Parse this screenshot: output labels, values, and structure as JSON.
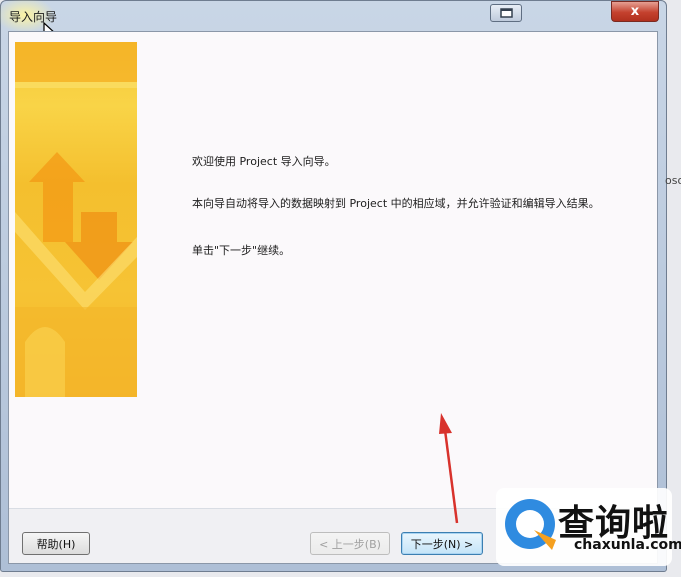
{
  "window": {
    "title": "导入向导",
    "close_glyph": "x"
  },
  "message": {
    "line1": "欢迎使用 Project 导入向导。",
    "line2": "本向导自动将导入的数据映射到 Project 中的相应域，并允许验证和编辑导入结果。",
    "line3": "单击\"下一步\"继续。"
  },
  "buttons": {
    "help": "帮助(H)",
    "back": "< 上一步(B)",
    "next": "下一步(N) >"
  },
  "watermark": {
    "main": "查询啦",
    "sub": "chaxunla.com"
  },
  "background_fragment": "oso",
  "colors": {
    "banner_yellow": "#f6c838",
    "close_red": "#c4412e",
    "annotation_red": "#d8322c",
    "watermark_blue": "#2f8be0",
    "watermark_orange": "#f5a020"
  },
  "icons": {
    "cursor": "mouse-pointer-icon",
    "restore": "restore-window-icon",
    "close": "close-icon",
    "annotation": "red-arrow-annotation"
  }
}
